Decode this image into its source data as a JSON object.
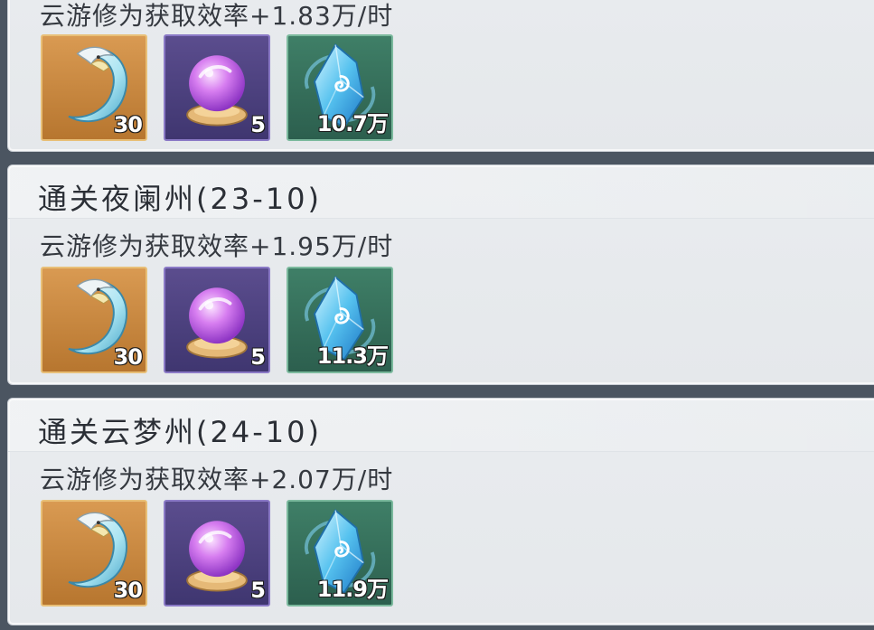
{
  "rewards": [
    {
      "title": "",
      "rate": "云游修为获取效率+1.83万/时",
      "items": [
        {
          "icon": "feather-crescent-icon",
          "count": "30"
        },
        {
          "icon": "purple-orb-icon",
          "count": "5"
        },
        {
          "icon": "blue-crystal-icon",
          "count": "10.7万"
        }
      ]
    },
    {
      "title": "通关夜阑州(23-10)",
      "rate": "云游修为获取效率+1.95万/时",
      "items": [
        {
          "icon": "feather-crescent-icon",
          "count": "30"
        },
        {
          "icon": "purple-orb-icon",
          "count": "5"
        },
        {
          "icon": "blue-crystal-icon",
          "count": "11.3万"
        }
      ]
    },
    {
      "title": "通关云梦州(24-10)",
      "rate": "云游修为获取效率+2.07万/时",
      "items": [
        {
          "icon": "feather-crescent-icon",
          "count": "30"
        },
        {
          "icon": "purple-orb-icon",
          "count": "5"
        },
        {
          "icon": "blue-crystal-icon",
          "count": "11.9万"
        }
      ]
    }
  ],
  "colors": {
    "gold_slot": "#c98a43",
    "purple_slot": "#4d4280",
    "green_slot": "#356e5a",
    "card_bg": "#e7eaed"
  }
}
